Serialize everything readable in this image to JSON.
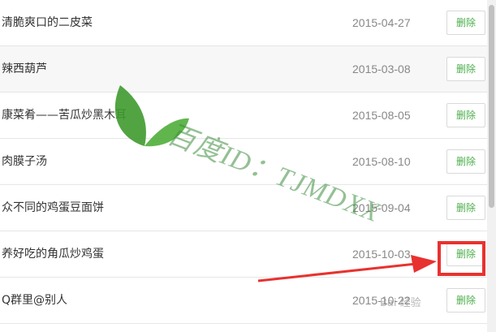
{
  "recipes": [
    {
      "title": "清脆爽口的二皮菜",
      "date": "2015-04-27",
      "delete_label": "删除"
    },
    {
      "title": "辣西葫芦",
      "date": "2015-03-08",
      "delete_label": "删除"
    },
    {
      "title": "康菜肴——苦瓜炒黑木耳",
      "date": "2015-08-05",
      "delete_label": "删除"
    },
    {
      "title": "肉膜子汤",
      "date": "2015-08-10",
      "delete_label": "删除"
    },
    {
      "title": "众不同的鸡蛋豆面饼",
      "date": "2015-09-04",
      "delete_label": "删除"
    },
    {
      "title": "养好吃的角瓜炒鸡蛋",
      "date": "2015-10-03",
      "delete_label": "删除"
    },
    {
      "title": "Q群里@别人",
      "date": "2015-10-22",
      "delete_label": "删除"
    }
  ],
  "watermark": {
    "text": "百度ID：TJMDXX",
    "color": "#3c8c3c"
  },
  "corner_logo": "Bai 经验",
  "annotation": {
    "color": "#e8322f",
    "target": "delete-button-row-6"
  }
}
